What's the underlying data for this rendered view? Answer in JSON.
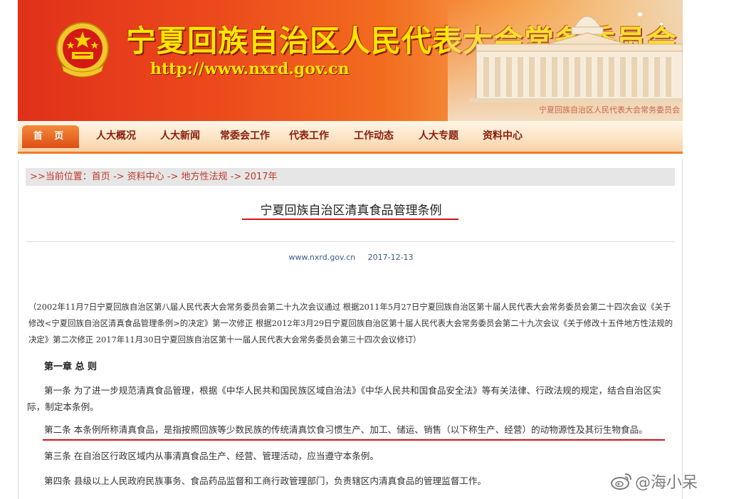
{
  "banner": {
    "title": "宁夏回族自治区人民代表大会常务委员会",
    "url": "http://www.nxrd.gov.cn",
    "caption": "宁夏回族自治区人民代表大会常务委员会"
  },
  "nav": {
    "home": "首 页",
    "items": [
      "人大概况",
      "人大新闻",
      "常委会工作",
      "代表工作",
      "工作动态",
      "人大专题",
      "资料中心"
    ]
  },
  "breadcrumb": {
    "prefix": ">>当前位置：",
    "items": [
      "首页",
      "资料中心",
      "地方性法规",
      "2017年"
    ],
    "separator": " -> "
  },
  "article": {
    "title": "宁夏回族自治区清真食品管理条例",
    "source": "www.nxrd.gov.cn",
    "date": "2017-12-13",
    "preamble": "（2002年11月7日宁夏回族自治区第八届人民代表大会常务委员会第二十九次会议通过 根据2011年5月27日宁夏回族自治区第十届人民代表大会常务委员会第二十四次会议《关于修改<宁夏回族自治区清真食品管理条例>的决定》第一次修正 根据2012年3月29日宁夏回族自治区第十届人民代表大会常务委员会第二十九次会议《关于修改十五件地方性法规的决定》第二次修正 2017年11月30日宁夏回族自治区第十一届人民代表大会常务委员会第三十四次会议修订）",
    "chapter": "第一章 总 则",
    "paragraphs": [
      "第一条 为了进一步规范清真食品管理，根据《中华人民共和国民族区域自治法》《中华人民共和国食品安全法》等有关法律、行政法规的规定，结合自治区实际，制定本条例。",
      "第二条 本条例所称清真食品，是指按照回族等少数民族的传统清真饮食习惯生产、加工、储运、销售（以下称生产、经营）的动物源性及其衍生物食品。",
      "第三条 在自治区行政区域内从事清真食品生产、经营、管理活动，应当遵守本条例。",
      "第四条 县级以上人民政府民族事务、食品药品监督和工商行政管理部门，负责辖区内清真食品的管理监督工作。"
    ]
  },
  "watermark": {
    "text": "@海小呆"
  },
  "colors": {
    "title_yellow": "#ffe600",
    "nav_text": "#8a1c0c",
    "accent_red": "#d0161a",
    "breadcrumb_red": "#c0392b",
    "meta_blue": "#3a5a8a"
  }
}
